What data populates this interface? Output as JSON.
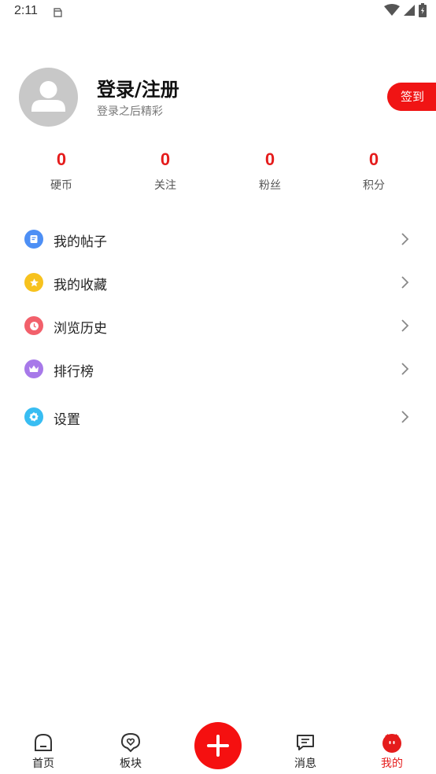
{
  "status_bar": {
    "time": "2:11",
    "icons": [
      "notification-icon",
      "wifi-icon",
      "signal-icon",
      "battery-icon"
    ]
  },
  "profile": {
    "title": "登录/注册",
    "subtitle": "登录之后精彩",
    "avatar_icon": "person-icon",
    "signin_label": "签到"
  },
  "stats": [
    {
      "value": "0",
      "label": "硬币"
    },
    {
      "value": "0",
      "label": "关注"
    },
    {
      "value": "0",
      "label": "粉丝"
    },
    {
      "value": "0",
      "label": "积分"
    }
  ],
  "menu": [
    {
      "label": "我的帖子",
      "icon": "note-icon",
      "color": "#4d8ff5"
    },
    {
      "label": "我的收藏",
      "icon": "star-icon",
      "color": "#f7c21e"
    },
    {
      "label": "浏览历史",
      "icon": "clock-icon",
      "color": "#f2606b"
    },
    {
      "label": "排行榜",
      "icon": "crown-icon",
      "color": "#a779e9"
    },
    {
      "label": "设置",
      "icon": "gear-icon",
      "color": "#38bdf2"
    }
  ],
  "bottom_nav": [
    {
      "label": "首页",
      "icon": "home-icon",
      "active": false
    },
    {
      "label": "板块",
      "icon": "section-icon",
      "active": false
    },
    {
      "label": "",
      "icon": "add-icon",
      "active": false
    },
    {
      "label": "消息",
      "icon": "message-icon",
      "active": false
    },
    {
      "label": "我的",
      "icon": "mine-icon",
      "active": true
    }
  ],
  "colors": {
    "accent": "#e51c1c",
    "add_button": "#f51010"
  }
}
